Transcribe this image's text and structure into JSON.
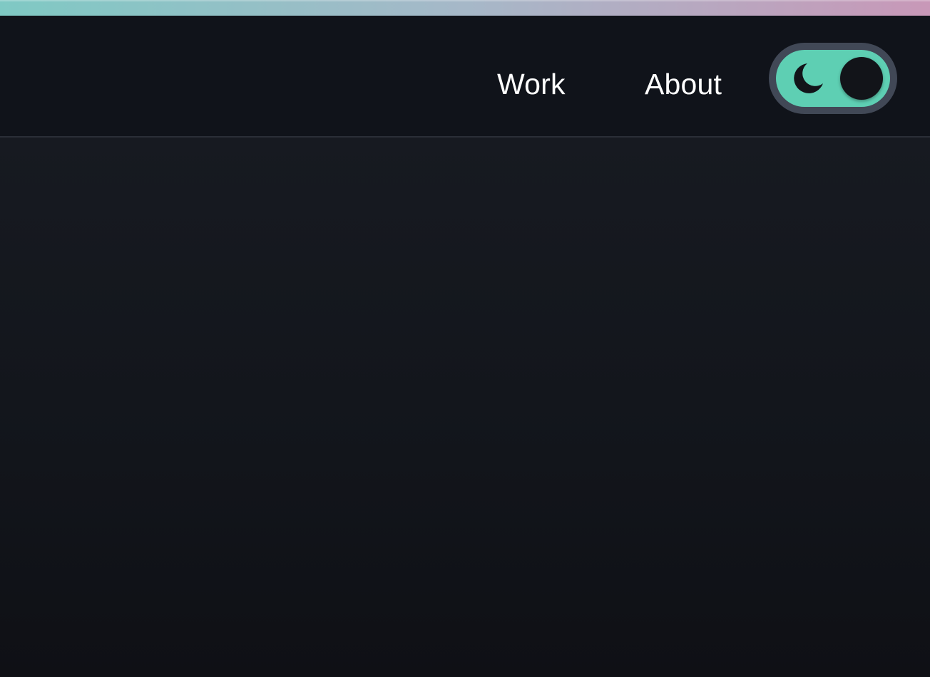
{
  "header": {
    "nav": [
      {
        "label": "Work"
      },
      {
        "label": "About"
      }
    ],
    "theme_toggle": {
      "state": "dark",
      "icon": "moon-icon"
    }
  },
  "colors": {
    "stripe_start": "#7fc9c4",
    "stripe_end": "#c898b8",
    "header_bg": "#10131a",
    "page_bg": "#14171e",
    "toggle_track": "#5ecfb3",
    "toggle_border": "#414856",
    "toggle_knob": "#121419",
    "nav_text": "#ffffff"
  }
}
